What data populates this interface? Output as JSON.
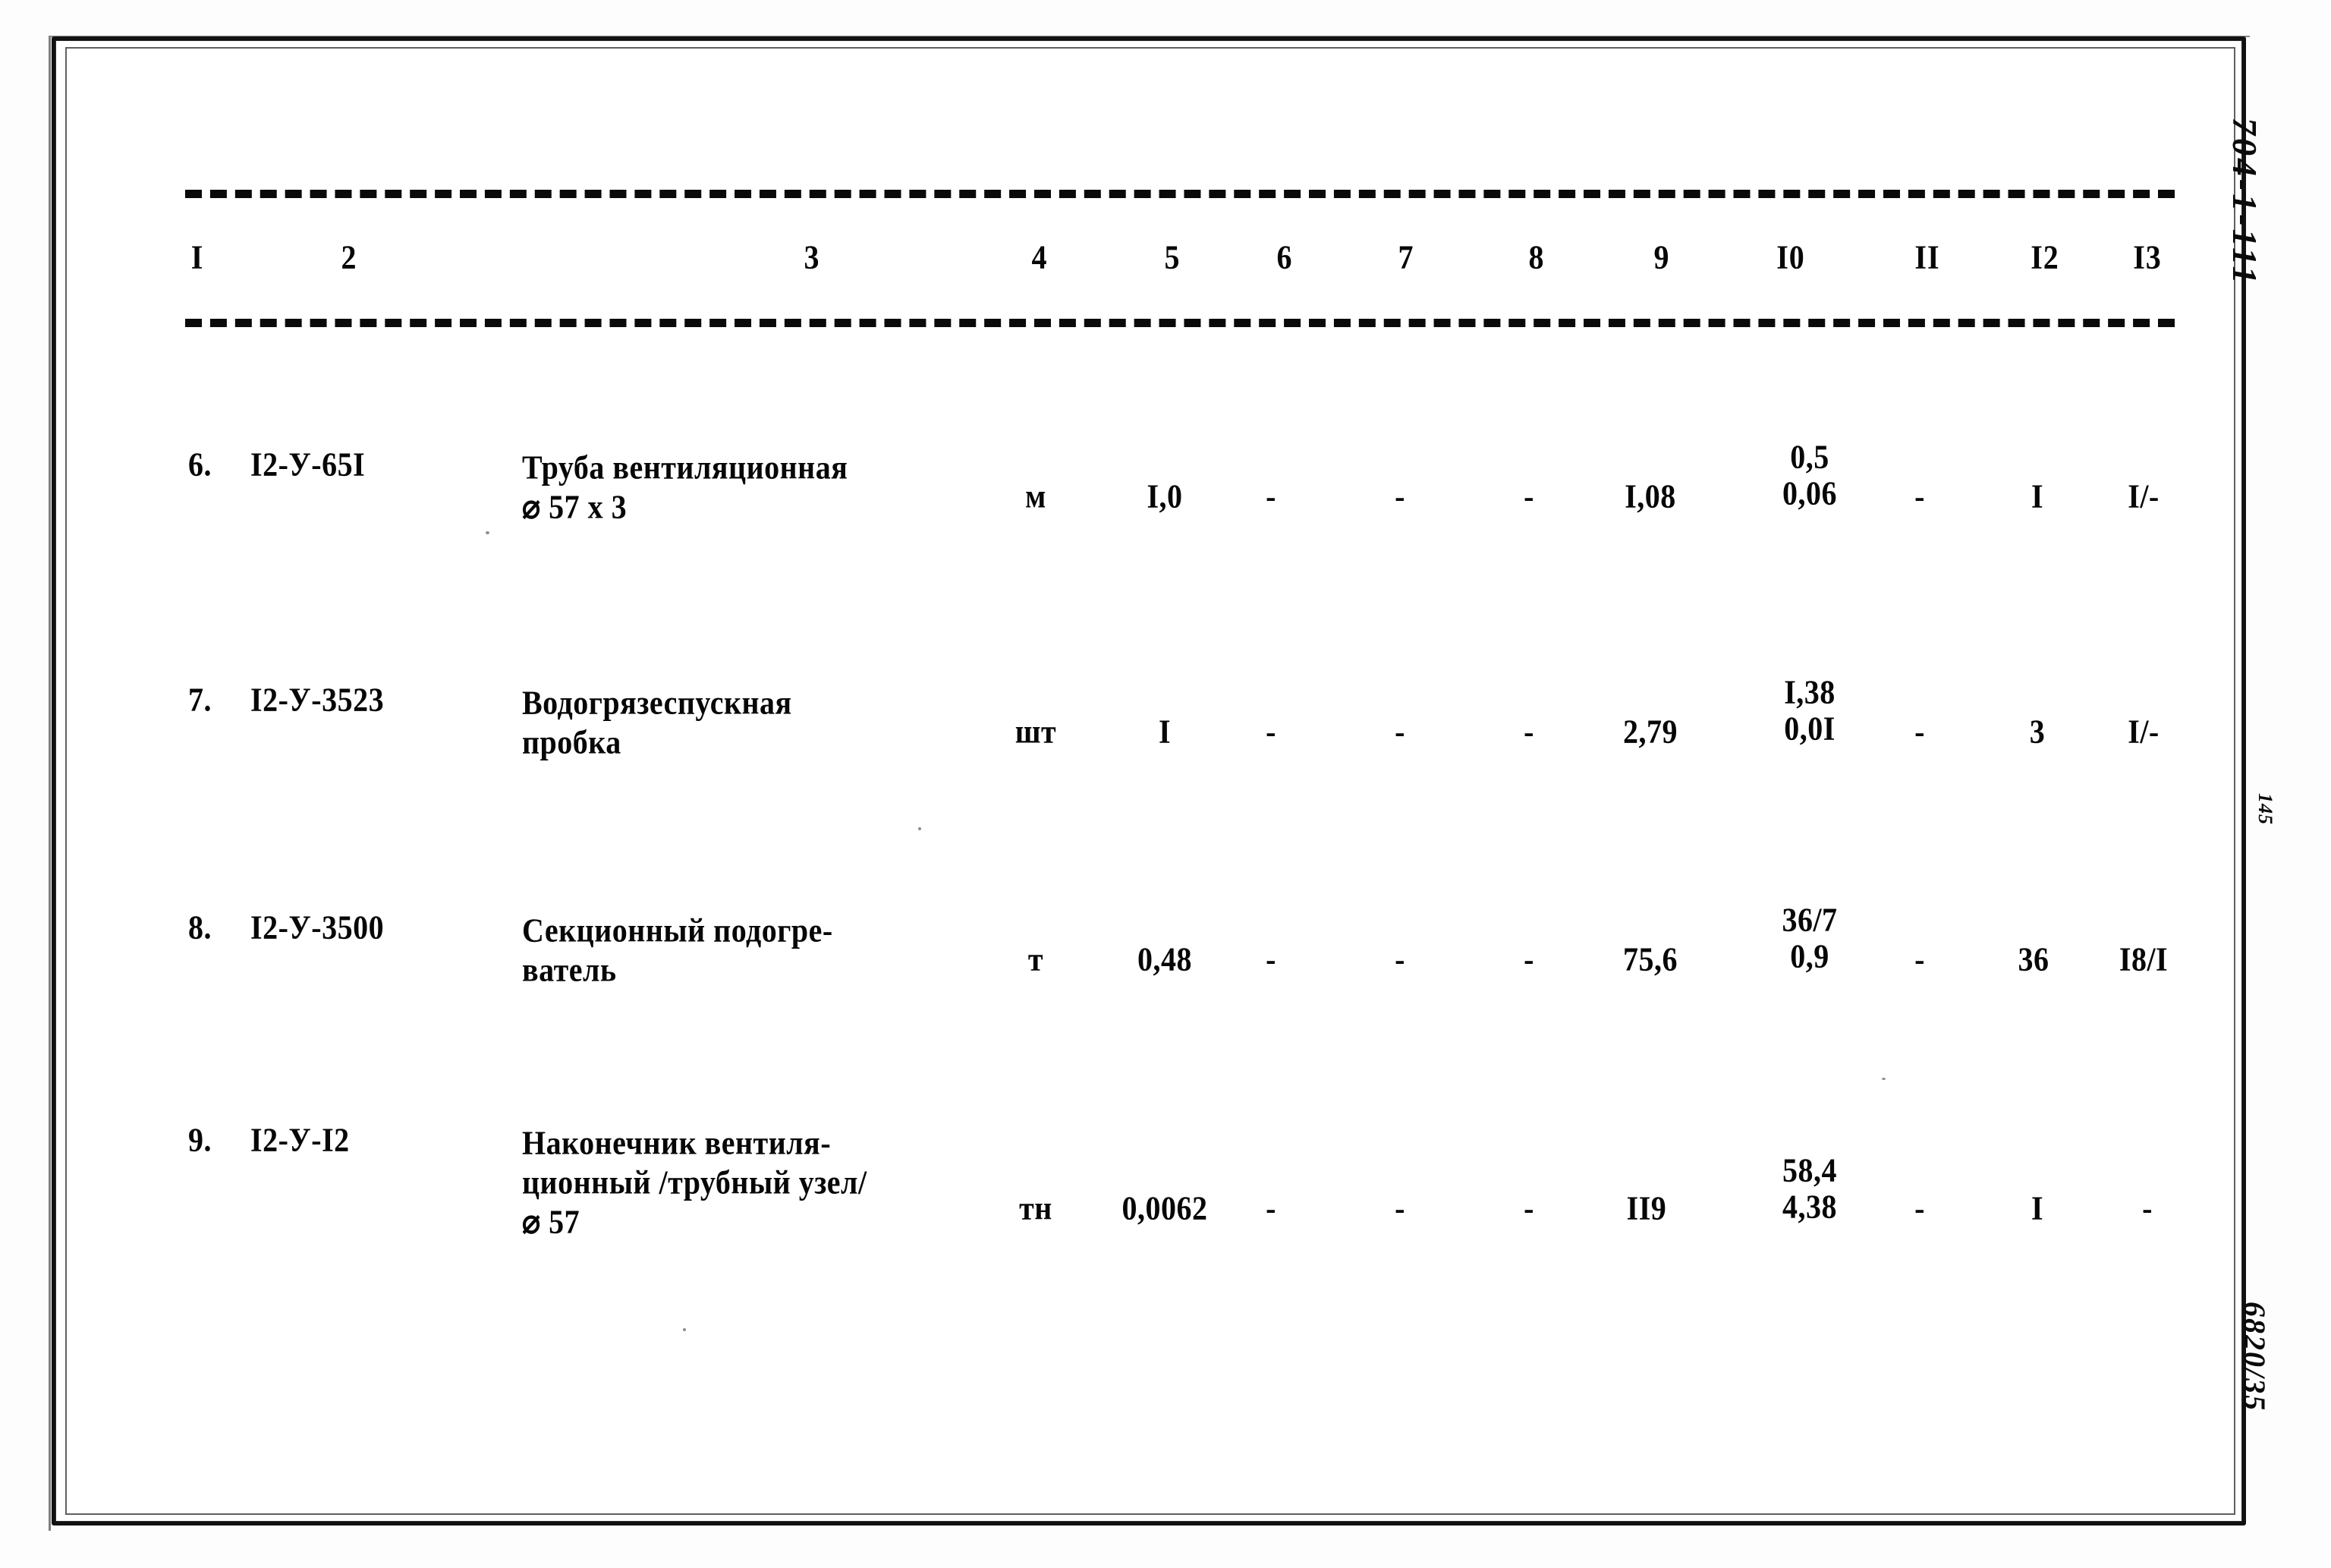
{
  "document": {
    "type": "scanned-table-page",
    "ink_color": "#070707",
    "paper_color": "#ffffff"
  },
  "margin_notes": {
    "catalog_code": "704-1-111",
    "page_mark": "145",
    "bottom_mark": "6820/35"
  },
  "table": {
    "column_headers": [
      "I",
      "2",
      "3",
      "4",
      "5",
      "6",
      "7",
      "8",
      "9",
      "I0",
      "II",
      "I2",
      "I3"
    ],
    "rows": [
      {
        "num": "6.",
        "code": "I2-У-65I",
        "name_line1": "Труба вентиляционная",
        "name_line2": "⌀ 57 х 3",
        "name_line3": "",
        "unit": "м",
        "c5": "I,0",
        "c6": "-",
        "c7": "-",
        "c8": "-",
        "c9": "I,08",
        "c10_top": "0,5",
        "c10_bottom": "0,06",
        "c11": "-",
        "c12": "I",
        "c13": "I/-"
      },
      {
        "num": "7.",
        "code": "I2-У-3523",
        "name_line1": "Водогрязеспускная",
        "name_line2": "пробка",
        "name_line3": "",
        "unit": "шт",
        "c5": "I",
        "c6": "-",
        "c7": "-",
        "c8": "-",
        "c9": "2,79",
        "c10_top": "I,38",
        "c10_bottom": "0,0I",
        "c11": "-",
        "c12": "3",
        "c13": "I/-"
      },
      {
        "num": "8.",
        "code": "I2-У-3500",
        "name_line1": "Секционный подогре-",
        "name_line2": "ватель",
        "name_line3": "",
        "unit": "т",
        "c5": "0,48",
        "c6": "-",
        "c7": "-",
        "c8": "-",
        "c9": "75,6",
        "c10_top": "36/7",
        "c10_bottom": "0,9",
        "c11": "-",
        "c12": "36",
        "c13": "I8/I"
      },
      {
        "num": "9.",
        "code": "I2-У-I2",
        "name_line1": "Наконечник вентиля-",
        "name_line2": "ционный /трубный узел/",
        "name_line3": "⌀ 57",
        "unit": "тн",
        "c5": "0,0062",
        "c6": "-",
        "c7": "-",
        "c8": "-",
        "c9": "II9",
        "c10_top": "58,4",
        "c10_bottom": "4,38",
        "c11": "-",
        "c12": "I",
        "c13": "-"
      }
    ]
  }
}
